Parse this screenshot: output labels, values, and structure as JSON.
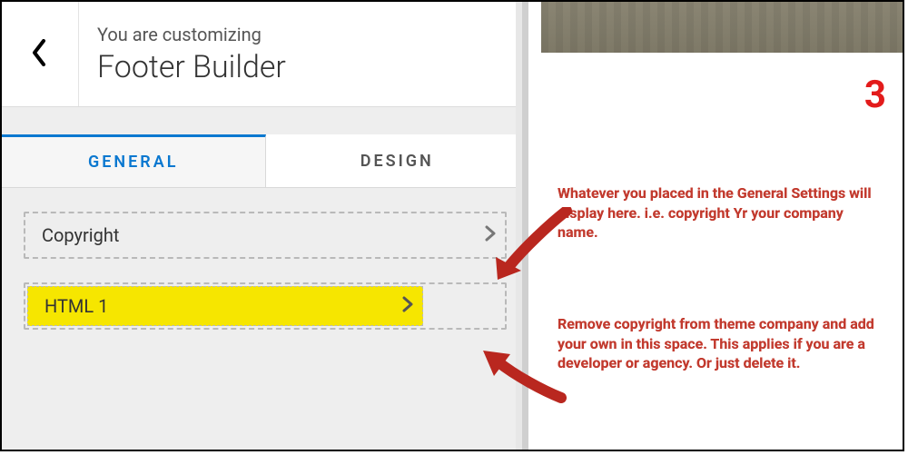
{
  "header": {
    "subtitle": "You are customizing",
    "title": "Footer Builder"
  },
  "tabs": {
    "general": "GENERAL",
    "design": "DESIGN"
  },
  "controls": {
    "copyright": "Copyright",
    "html1": "HTML 1"
  },
  "annotations": {
    "step_number": "3",
    "top": "Whatever you placed in the General Settings will display here. i.e. copyright Yr your company name.",
    "bottom": "Remove copyright from theme company and add your own in this space. This applies if you are a developer or agency. Or just delete it."
  }
}
